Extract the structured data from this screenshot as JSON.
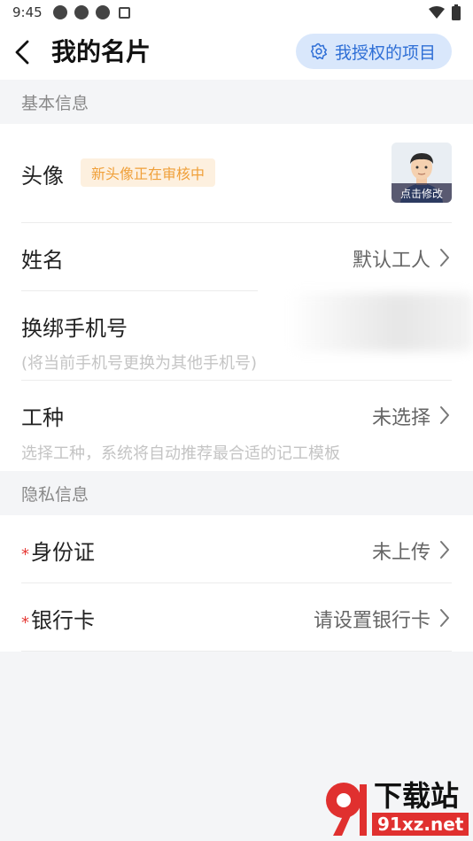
{
  "status_bar": {
    "time": "9:45"
  },
  "header": {
    "title": "我的名片",
    "auth_button": "我授权的项目"
  },
  "sections": {
    "basic": "基本信息",
    "privacy": "隐私信息"
  },
  "basic_info": {
    "avatar": {
      "label": "头像",
      "badge": "新头像正在审核中",
      "edit_label": "点击修改"
    },
    "name": {
      "label": "姓名",
      "value": "默认工人"
    },
    "phone": {
      "label": "换绑手机号",
      "hint": "(将当前手机号更换为其他手机号)"
    },
    "trade": {
      "label": "工种",
      "value": "未选择",
      "hint": "选择工种，系统将自动推荐最合适的记工模板"
    }
  },
  "privacy_info": {
    "id_card": {
      "required": "*",
      "label": "身份证",
      "value": "未上传"
    },
    "bank_card": {
      "required": "*",
      "label": "银行卡",
      "value": "请设置银行卡"
    }
  },
  "watermark": {
    "brand": "下载站",
    "site": "91xz.net"
  },
  "colors": {
    "accent": "#2f6fd6",
    "badge_text": "#f0a03a",
    "required": "#e53935"
  }
}
